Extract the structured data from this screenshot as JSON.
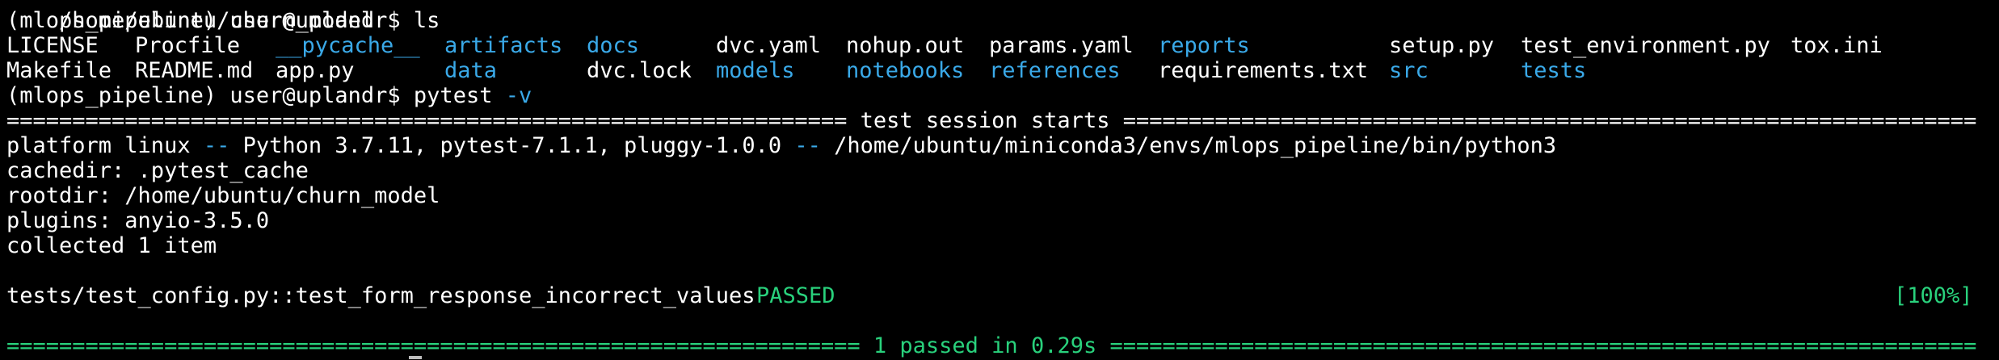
{
  "colors": {
    "background": "#000000",
    "foreground": "#ffffff",
    "directory": "#3aa9e8",
    "success": "#29d17c"
  },
  "lines": {
    "path_partial": "/home/ubuntu/churn_model",
    "prompt": "(mlops_pipeline) user@uplandr$ ",
    "cmd_ls": "ls",
    "cmd_pytest": "pytest",
    "cmd_pytest_flag": "-v",
    "sep_left_start": "==========================================================================",
    "session_title": " test session starts ",
    "sep_right_start": "==========================================================================",
    "platform_prefix": "platform linux ",
    "dashes": "--",
    "platform_mid": " Python 3.7.11, pytest-7.1.1, pluggy-1.0.0 ",
    "platform_path": " /home/ubuntu/miniconda3/envs/mlops_pipeline/bin/python3",
    "cachedir": "cachedir: .pytest_cache",
    "rootdir": "rootdir: /home/ubuntu/churn_model",
    "plugins": "plugins: anyio-3.5.0",
    "collected": "collected 1 item",
    "test_name": "tests/test_config.py::test_form_response_incorrect_values ",
    "test_status": "PASSED",
    "test_percent": "[100%]",
    "sep_left_end": "==========================================================================",
    "passed_count": "1 passed",
    "passed_in": " in 0.29s ",
    "sep_right_end": "=========================================================================="
  },
  "ls_output": {
    "row1": [
      {
        "name": "LICENSE",
        "dir": false
      },
      {
        "name": "Procfile",
        "dir": false
      },
      {
        "name": "__pycache__",
        "dir": true
      },
      {
        "name": "artifacts",
        "dir": true
      },
      {
        "name": "docs",
        "dir": true
      },
      {
        "name": "dvc.yaml",
        "dir": false
      },
      {
        "name": "nohup.out",
        "dir": false
      },
      {
        "name": "params.yaml",
        "dir": false
      },
      {
        "name": "reports",
        "dir": true
      },
      {
        "name": "setup.py",
        "dir": false
      },
      {
        "name": "test_environment.py",
        "dir": false
      },
      {
        "name": "tox.ini",
        "dir": false
      }
    ],
    "row2": [
      {
        "name": "Makefile",
        "dir": false
      },
      {
        "name": "README.md",
        "dir": false
      },
      {
        "name": "app.py",
        "dir": false
      },
      {
        "name": "data",
        "dir": true
      },
      {
        "name": "dvc.lock",
        "dir": false
      },
      {
        "name": "models",
        "dir": true
      },
      {
        "name": "notebooks",
        "dir": true
      },
      {
        "name": "references",
        "dir": true
      },
      {
        "name": "requirements.txt",
        "dir": false
      },
      {
        "name": "src",
        "dir": true
      },
      {
        "name": "tests",
        "dir": true
      }
    ]
  }
}
